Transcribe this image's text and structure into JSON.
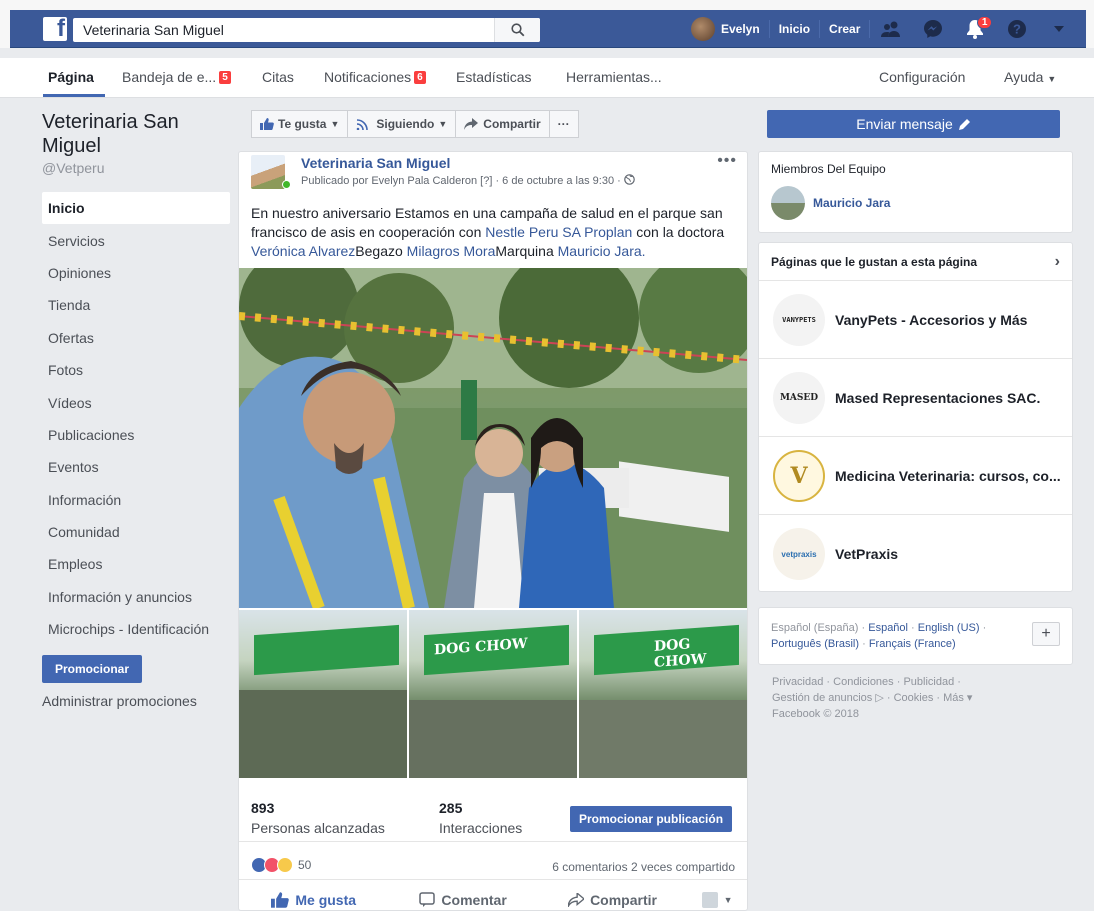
{
  "topbar": {
    "search_value": "Veterinaria San Miguel",
    "user_name": "Evelyn",
    "home": "Inicio",
    "create": "Crear",
    "notifications_count": "1",
    "colors": {
      "brand": "#3b5998",
      "badge": "#fa3e3e"
    }
  },
  "subnav": {
    "tabs": [
      {
        "label": "Página"
      },
      {
        "label": "Bandeja de e...",
        "badge": "5"
      },
      {
        "label": "Citas"
      },
      {
        "label": "Notificaciones",
        "badge": "6"
      },
      {
        "label": "Estadísticas"
      },
      {
        "label": "Herramientas..."
      }
    ],
    "settings": "Configuración",
    "help": "Ayuda"
  },
  "sidebar": {
    "page_name": "Veterinaria San Miguel",
    "handle": "@Vetperu",
    "items": [
      {
        "label": "Inicio"
      },
      {
        "label": "Servicios"
      },
      {
        "label": "Opiniones"
      },
      {
        "label": "Tienda"
      },
      {
        "label": "Ofertas"
      },
      {
        "label": "Fotos"
      },
      {
        "label": "Vídeos"
      },
      {
        "label": "Publicaciones"
      },
      {
        "label": "Eventos"
      },
      {
        "label": "Información"
      },
      {
        "label": "Comunidad"
      },
      {
        "label": "Empleos"
      },
      {
        "label": "Información y anuncios"
      },
      {
        "label": "Microchips - Identificación"
      }
    ],
    "promote": "Promocionar",
    "manage_promos": "Administrar promociones"
  },
  "actions": {
    "like": "Te gusta",
    "following": "Siguiendo",
    "share": "Compartir",
    "more": "···"
  },
  "post": {
    "page_name": "Veterinaria San Miguel",
    "meta": "Publicado por Evelyn Pala Calderon [?] · 6 de octubre a las 9:30 ·",
    "text_1": "En nuestro aniversario Estamos en una campaña de salud en el parque san francisco de asis en cooperación con ",
    "link_1": "Nestle Peru SA Proplan",
    "text_2": " con la doctora ",
    "link_2": "Verónica Alvarez",
    "text_3": "Begazo ",
    "link_3": "Milagros Mora",
    "text_4": "Marquina ",
    "link_4": "Mauricio Jara.",
    "thumb_tent_text": "DOG CHOW",
    "reach_number": "893",
    "reach_label": "Personas alcanzadas",
    "interactions_number": "285",
    "interactions_label": "Interacciones",
    "promote_button": "Promocionar publicación",
    "reactions_count": "50",
    "comments_shares": "6 comentarios  2 veces compartido",
    "like_action": "Me gusta",
    "comment_action": "Comentar",
    "share_action": "Compartir"
  },
  "right": {
    "send_message": "Enviar mensaje",
    "team_title": "Miembros Del Equipo",
    "team_member": "Mauricio Jara",
    "liked_title": "Páginas que le gustan a esta página",
    "liked_pages": [
      {
        "name": "VanyPets - Accesorios y Más",
        "logo": "VANYPETS"
      },
      {
        "name": "Mased Representaciones SAC.",
        "logo": "MASED"
      },
      {
        "name": "Medicina Veterinaria: cursos, co...",
        "logo": "V"
      },
      {
        "name": "VetPraxis",
        "logo": "vetpraxis"
      }
    ],
    "languages": {
      "current": "Español (España)",
      "others": [
        "Español",
        "English (US)",
        "Português (Brasil)",
        "Français (France)"
      ]
    },
    "footer": {
      "line1": "Privacidad · Condiciones · Publicidad ·",
      "line2": "Gestión de anuncios ▷ · Cookies · Más ▾",
      "line3": "Facebook © 2018"
    }
  }
}
